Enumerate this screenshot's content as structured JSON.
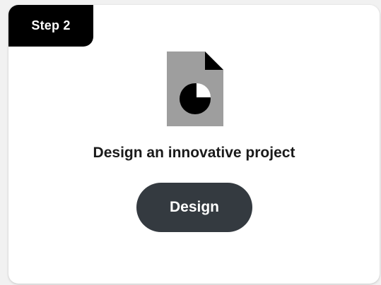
{
  "card": {
    "step_label": "Step 2",
    "icon": "document-pie-chart-icon",
    "title": "Design an innovative project",
    "button_label": "Design"
  },
  "colors": {
    "badge_background": "#000000",
    "button_background": "#343a40",
    "icon_gray": "#9e9e9e"
  }
}
